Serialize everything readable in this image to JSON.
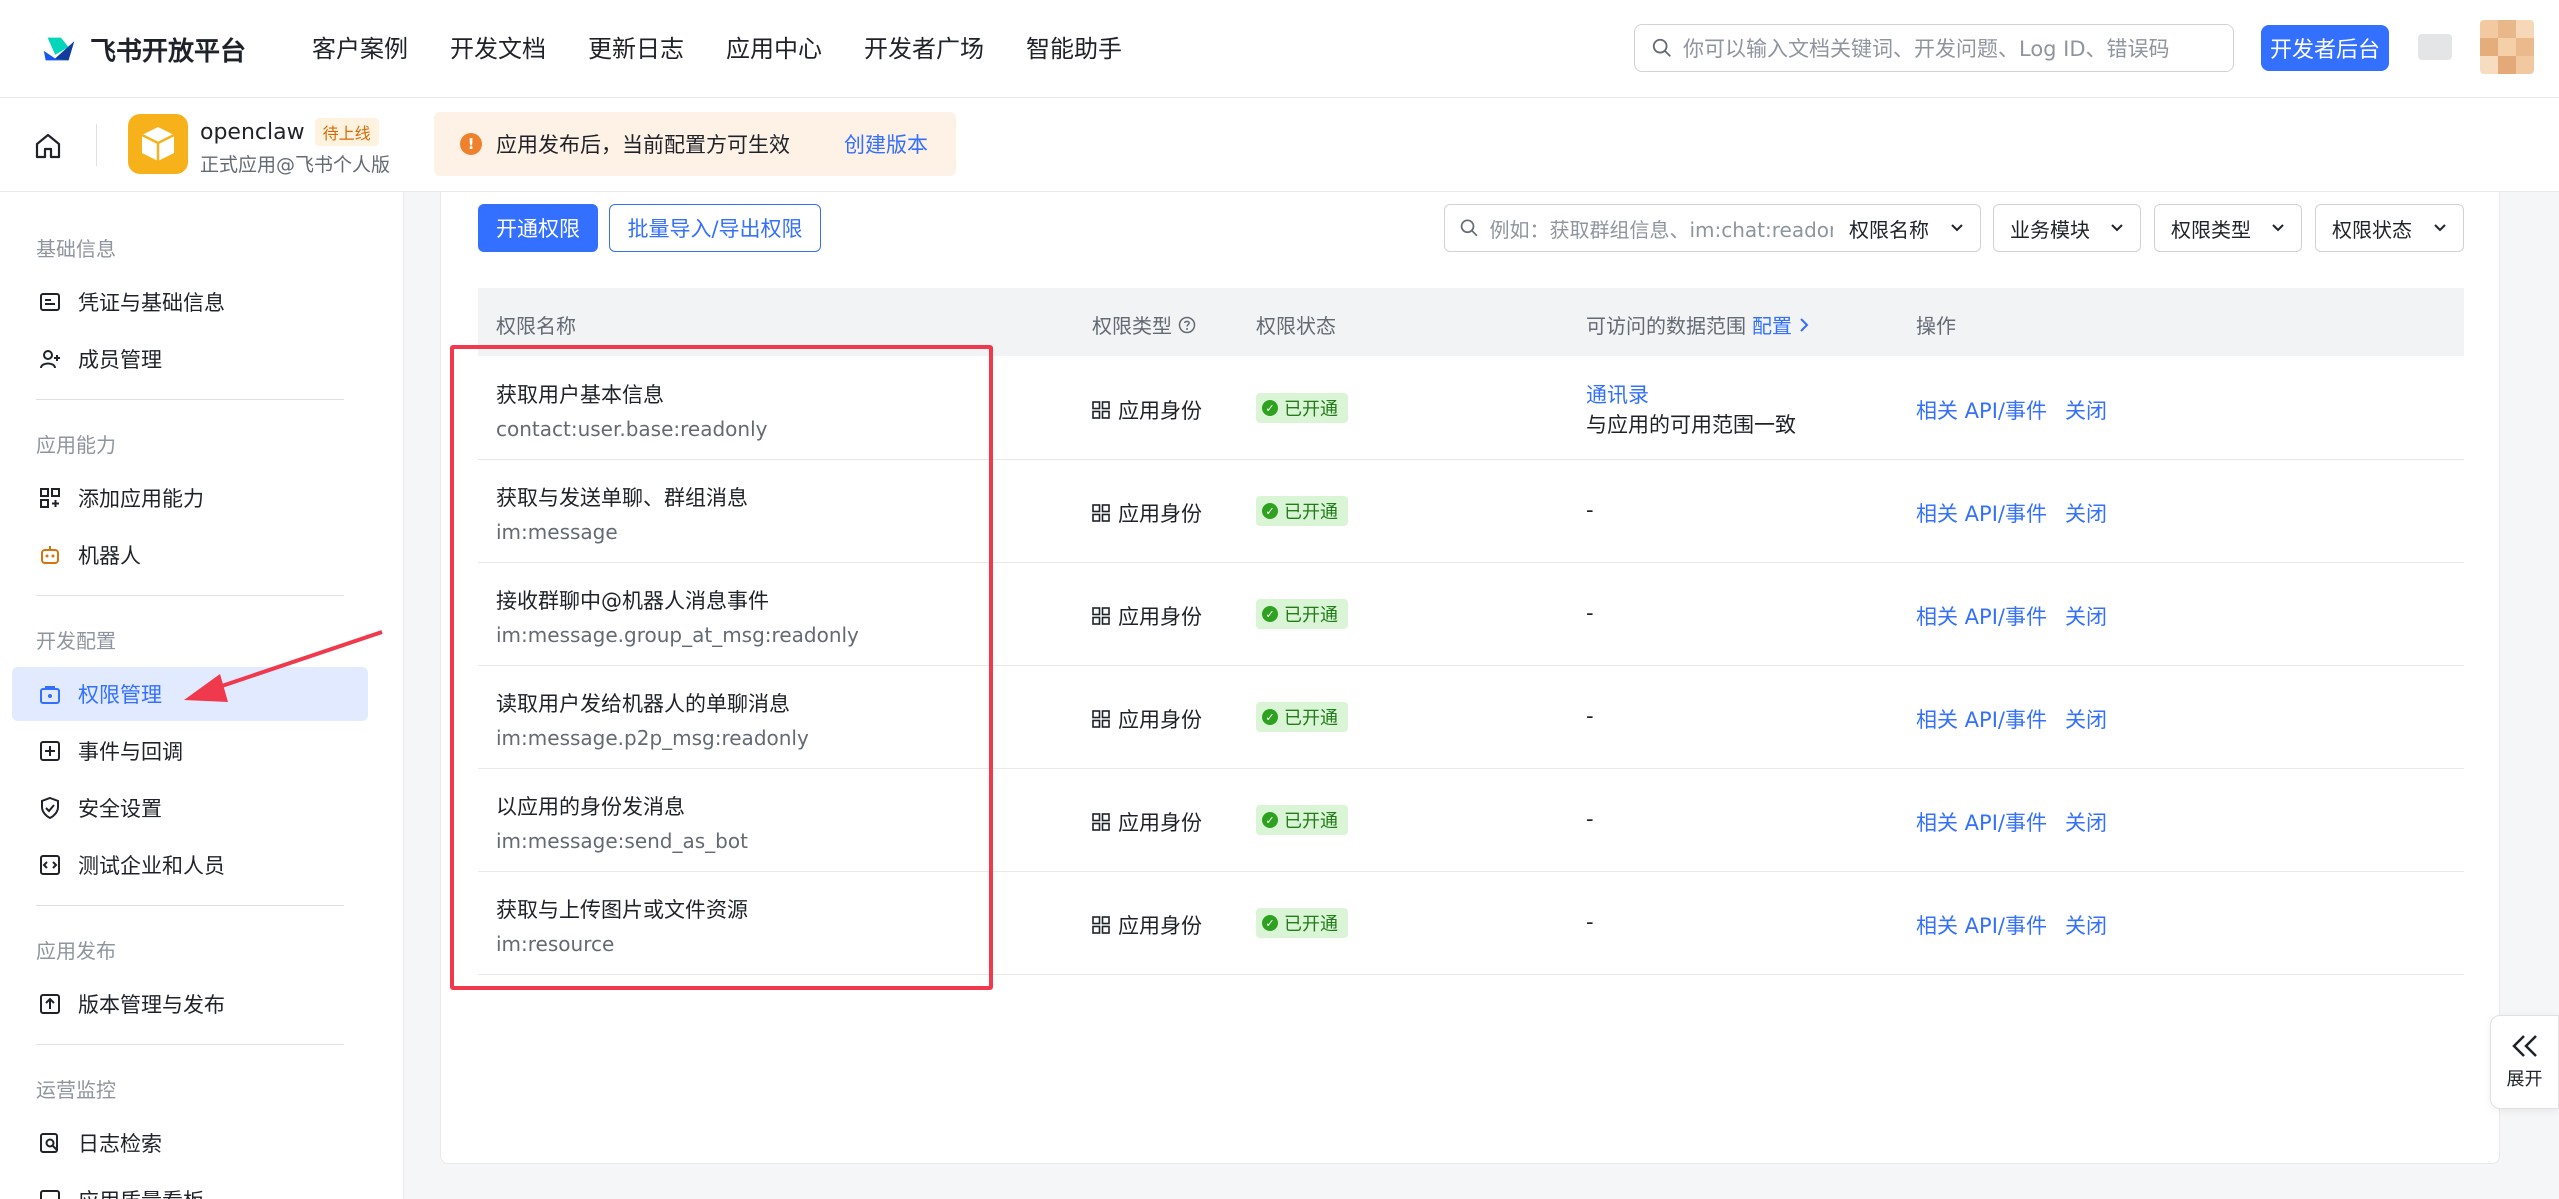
{
  "brand": {
    "name": "飞书开放平台"
  },
  "nav": [
    "客户案例",
    "开发文档",
    "更新日志",
    "应用中心",
    "开发者广场",
    "智能助手"
  ],
  "search": {
    "placeholder": "你可以输入文档关键词、开发问题、Log ID、错误码"
  },
  "dev_console_button": "开发者后台",
  "app": {
    "name": "openclaw",
    "badge": "待上线",
    "subtitle": "正式应用@飞书个人版"
  },
  "notice": {
    "text": "应用发布后，当前配置方可生效",
    "link": "创建版本"
  },
  "sidebar": {
    "sections": [
      {
        "title": "基础信息",
        "items": [
          "凭证与基础信息",
          "成员管理"
        ]
      },
      {
        "title": "应用能力",
        "items": [
          "添加应用能力",
          "机器人"
        ]
      },
      {
        "title": "开发配置",
        "items": [
          "权限管理",
          "事件与回调",
          "安全设置",
          "测试企业和人员"
        ]
      },
      {
        "title": "应用发布",
        "items": [
          "版本管理与发布"
        ]
      },
      {
        "title": "运营监控",
        "items": [
          "日志检索",
          "应用质量看板"
        ]
      }
    ],
    "active": "权限管理"
  },
  "toolbar": {
    "enable_button": "开通权限",
    "batch_button": "批量导入/导出权限",
    "filter_placeholder": "例如：获取群组信息、im:chat:readonly",
    "filters": [
      "权限名称",
      "业务模块",
      "权限类型",
      "权限状态"
    ]
  },
  "table": {
    "headers": {
      "name": "权限名称",
      "type": "权限类型",
      "status": "权限状态",
      "scope": "可访问的数据范围",
      "scope_link": "配置",
      "ops": "操作"
    },
    "rows": [
      {
        "title": "获取用户基本信息",
        "code": "contact:user.base:readonly",
        "type": "应用身份",
        "status": "已开通",
        "scope_link": "通讯录",
        "scope": "与应用的可用范围一致",
        "op1": "相关 API/事件",
        "op2": "关闭"
      },
      {
        "title": "获取与发送单聊、群组消息",
        "code": "im:message",
        "type": "应用身份",
        "status": "已开通",
        "scope": "-",
        "op1": "相关 API/事件",
        "op2": "关闭"
      },
      {
        "title": "接收群聊中@机器人消息事件",
        "code": "im:message.group_at_msg:readonly",
        "type": "应用身份",
        "status": "已开通",
        "scope": "-",
        "op1": "相关 API/事件",
        "op2": "关闭"
      },
      {
        "title": "读取用户发给机器人的单聊消息",
        "code": "im:message.p2p_msg:readonly",
        "type": "应用身份",
        "status": "已开通",
        "scope": "-",
        "op1": "相关 API/事件",
        "op2": "关闭"
      },
      {
        "title": "以应用的身份发消息",
        "code": "im:message:send_as_bot",
        "type": "应用身份",
        "status": "已开通",
        "scope": "-",
        "op1": "相关 API/事件",
        "op2": "关闭"
      },
      {
        "title": "获取与上传图片或文件资源",
        "code": "im:resource",
        "type": "应用身份",
        "status": "已开通",
        "scope": "-",
        "op1": "相关 API/事件",
        "op2": "关闭"
      }
    ]
  },
  "expand_button": "展开",
  "colors": {
    "accent": "#3370ff",
    "annotation": "#f0394d",
    "success": "#2ea121"
  }
}
